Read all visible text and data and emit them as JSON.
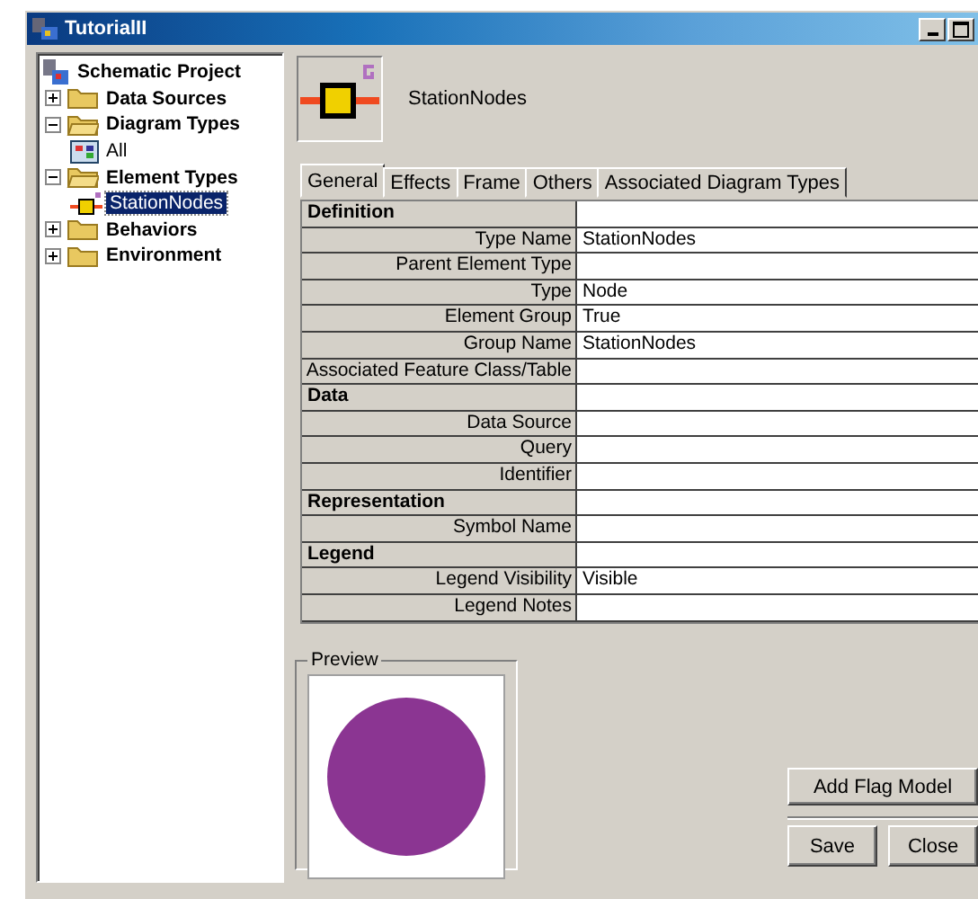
{
  "window": {
    "title": "TutorialII"
  },
  "tree": [
    {
      "label": "Schematic Project",
      "kind": "project",
      "selected": false,
      "children": [
        {
          "label": "Data Sources",
          "kind": "folder",
          "selected": false,
          "expanded": false
        },
        {
          "label": "Diagram Types",
          "kind": "folder",
          "selected": false,
          "expanded": true,
          "children": [
            {
              "label": "All",
              "kind": "diagram",
              "selected": false
            }
          ]
        },
        {
          "label": "Element Types",
          "kind": "folder",
          "selected": false,
          "expanded": true,
          "children": [
            {
              "label": "StationNodes",
              "kind": "element",
              "selected": true
            }
          ]
        },
        {
          "label": "Behaviors",
          "kind": "folder",
          "selected": false,
          "expanded": false
        },
        {
          "label": "Environment",
          "kind": "folder",
          "selected": false,
          "expanded": false
        }
      ]
    }
  ],
  "header": {
    "name": "StationNodes"
  },
  "tabs": [
    {
      "label": "General",
      "selected": true
    },
    {
      "label": "Effects",
      "selected": false
    },
    {
      "label": "Frame",
      "selected": false
    },
    {
      "label": "Others",
      "selected": false
    },
    {
      "label": "Associated Diagram Types",
      "selected": false
    }
  ],
  "properties": [
    {
      "kind": "section",
      "label": "Definition"
    },
    {
      "kind": "property",
      "label": "Type Name",
      "value": "StationNodes"
    },
    {
      "kind": "property",
      "label": "Parent Element Type"
    },
    {
      "kind": "property",
      "label": "Type",
      "value": "Node"
    },
    {
      "kind": "property",
      "label": "Element Group",
      "value": "True"
    },
    {
      "kind": "property",
      "label": "Group Name",
      "value": "StationNodes"
    },
    {
      "kind": "property",
      "label": "Associated Feature Class/Table"
    },
    {
      "kind": "section",
      "label": "Data"
    },
    {
      "kind": "property",
      "label": "Data Source"
    },
    {
      "kind": "property",
      "label": "Query"
    },
    {
      "kind": "property",
      "label": "Identifier"
    },
    {
      "kind": "section",
      "label": "Representation"
    },
    {
      "kind": "property",
      "label": "Symbol Name"
    },
    {
      "kind": "section",
      "label": "Legend"
    },
    {
      "kind": "property",
      "label": "Legend Visibility",
      "value": "Visible"
    },
    {
      "kind": "property",
      "label": "Legend Notes"
    }
  ],
  "preview": {
    "title": "Preview",
    "color": "#8b3592"
  },
  "buttons": {
    "add_flag": "Add Flag Model",
    "save": "Save",
    "close": "Close"
  }
}
